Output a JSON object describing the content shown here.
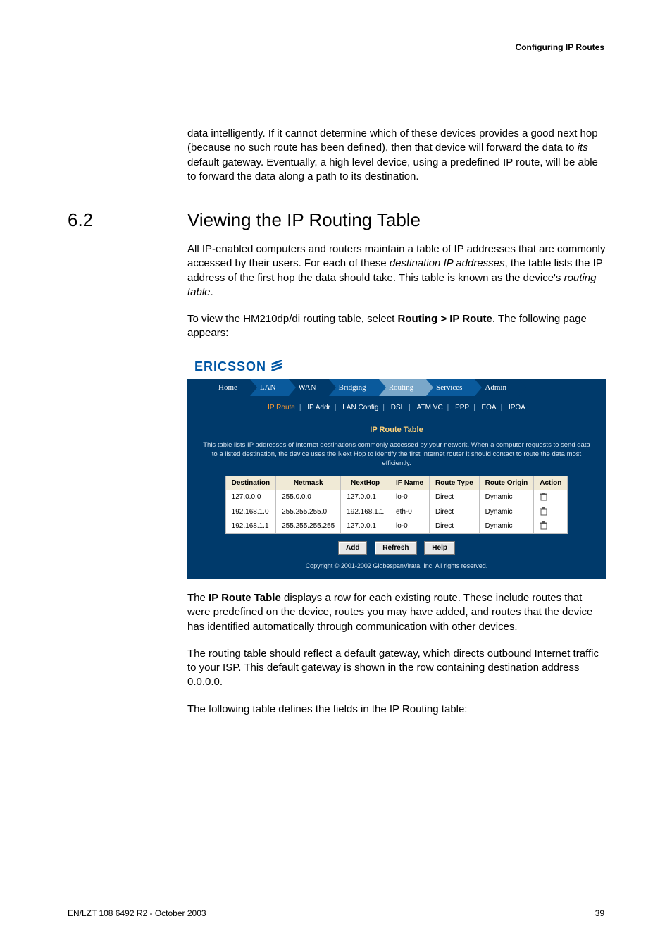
{
  "header_right": "Configuring IP Routes",
  "intro_para_html": "data intelligently. If it cannot determine which of these devices provides a good next hop (because no such route has been defined), then that device will forward the data to <em>its</em> default gateway. Eventually, a high level device, using a predefined IP route, will be able to forward the data along a path to its destination.",
  "section_num": "6.2",
  "section_title": "Viewing the IP Routing Table",
  "p1_html": "All IP-enabled computers and routers maintain a table of IP addresses that are commonly accessed by their users. For each of these <em>destination IP addresses</em>, the table lists the IP address of the first hop the data should take. This table is known as the device's <em>routing table</em>.",
  "p2_html": "To view the HM210dp/di routing table, select <b>Routing &gt; IP Route</b>. The following page appears:",
  "shot": {
    "logo_text": "ERICSSON",
    "tabs": [
      "Home",
      "LAN",
      "WAN",
      "Bridging",
      "Routing",
      "Services",
      "Admin"
    ],
    "tabs_active_index": 4,
    "subnav": [
      "IP Route",
      "IP Addr",
      "LAN Config",
      "DSL",
      "ATM VC",
      "PPP",
      "EOA",
      "IPOA"
    ],
    "subnav_active_index": 0,
    "panel_title": "IP Route Table",
    "panel_desc": "This table lists IP addresses of Internet destinations commonly accessed by your network. When a computer requests to send data to a listed destination, the device uses the Next Hop to identify the first Internet router it should contact to route the data most efficiently.",
    "columns": [
      "Destination",
      "Netmask",
      "NextHop",
      "IF Name",
      "Route Type",
      "Route Origin",
      "Action"
    ],
    "rows": [
      {
        "dest": "127.0.0.0",
        "mask": "255.0.0.0",
        "hop": "127.0.0.1",
        "if": "lo-0",
        "type": "Direct",
        "origin": "Dynamic"
      },
      {
        "dest": "192.168.1.0",
        "mask": "255.255.255.0",
        "hop": "192.168.1.1",
        "if": "eth-0",
        "type": "Direct",
        "origin": "Dynamic"
      },
      {
        "dest": "192.168.1.1",
        "mask": "255.255.255.255",
        "hop": "127.0.0.1",
        "if": "lo-0",
        "type": "Direct",
        "origin": "Dynamic"
      }
    ],
    "buttons": {
      "add": "Add",
      "refresh": "Refresh",
      "help": "Help"
    },
    "copyright": "Copyright © 2001-2002 GlobespanVirata, Inc. All rights reserved."
  },
  "p3_html": "The <b>IP Route Table</b> displays a row for each existing route. These include routes that were predefined on the device, routes you may have added, and routes that the device has identified automatically through communication with other devices.",
  "p4": "The routing table should reflect a default gateway, which directs outbound Internet traffic to your ISP. This default gateway is shown in the row containing destination address 0.0.0.0.",
  "p5": "The following table defines the fields in the IP Routing table:",
  "footer_left": "EN/LZT 108 6492 R2 - October 2003",
  "footer_right": "39"
}
